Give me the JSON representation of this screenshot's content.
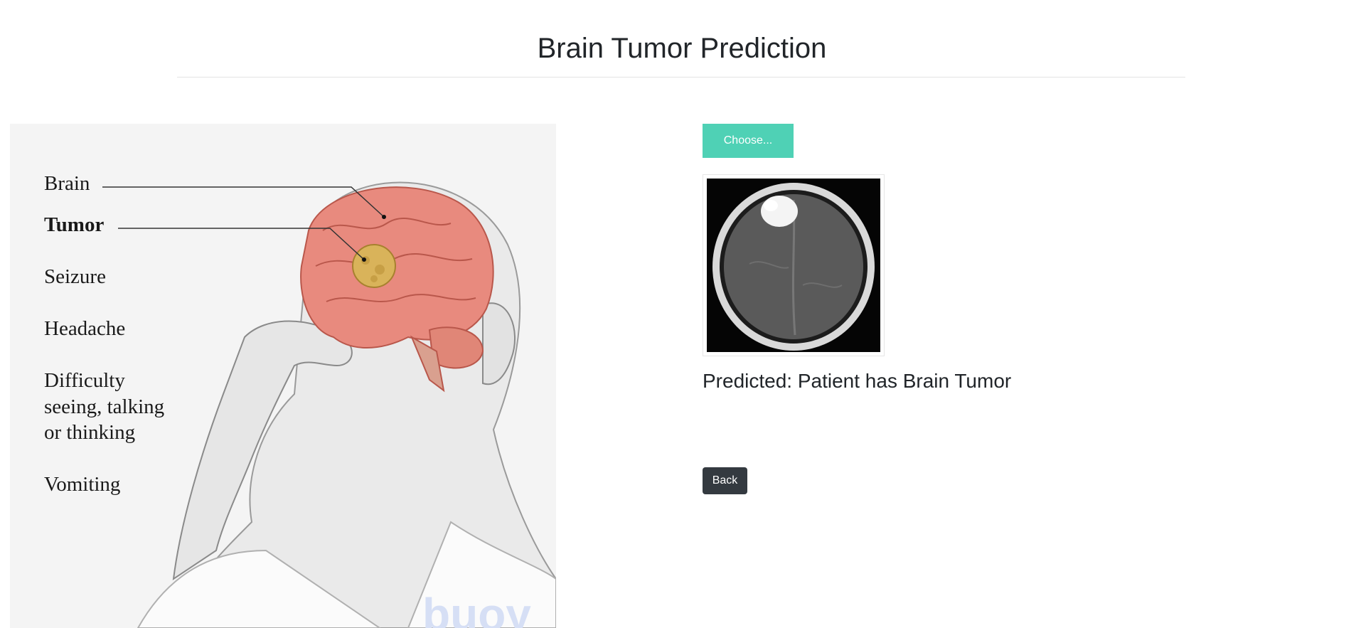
{
  "page": {
    "title": "Brain Tumor Prediction"
  },
  "illustration": {
    "labels": {
      "brain": "Brain",
      "tumor": "Tumor",
      "seizure": "Seizure",
      "headache": "Headache",
      "difficulty_line1": "Difficulty",
      "difficulty_line2": "seeing, talking",
      "difficulty_line3": "or thinking",
      "vomiting": "Vomiting"
    },
    "watermark": "buoy",
    "colors": {
      "brain": "#e88a7e",
      "tumor": "#d9b35a",
      "background": "#f4f4f4"
    }
  },
  "upload": {
    "choose_label": "Choose...",
    "button_color": "#4fd1b5"
  },
  "result": {
    "prediction_text": "Predicted: Patient has Brain Tumor"
  },
  "nav": {
    "back_label": "Back",
    "button_color": "#343a40"
  }
}
